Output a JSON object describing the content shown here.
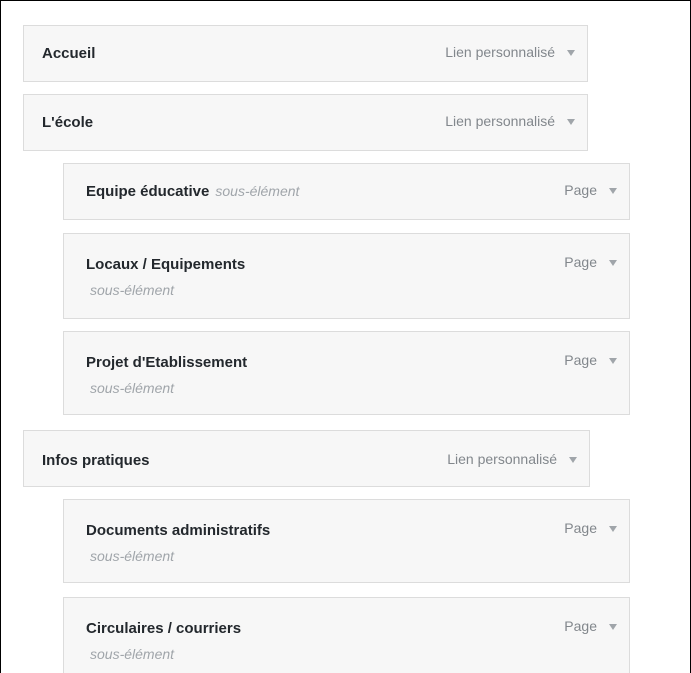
{
  "menu": {
    "items": [
      {
        "title": "Accueil",
        "type": "Lien personnalisé",
        "sub_label": ""
      },
      {
        "title": "L'école",
        "type": "Lien personnalisé",
        "sub_label": ""
      },
      {
        "title": "Equipe éducative",
        "type": "Page",
        "sub_label": "sous-élément"
      },
      {
        "title": "Locaux / Equipements",
        "type": "Page",
        "sub_label": "sous-élément"
      },
      {
        "title": "Projet d'Etablissement",
        "type": "Page",
        "sub_label": "sous-élément"
      },
      {
        "title": "Infos pratiques",
        "type": "Lien personnalisé",
        "sub_label": ""
      },
      {
        "title": "Documents administratifs",
        "type": "Page",
        "sub_label": "sous-élément"
      },
      {
        "title": "Circulaires / courriers",
        "type": "Page",
        "sub_label": "sous-élément"
      }
    ]
  },
  "icons": {
    "item_toggle": "triangle-down-icon"
  }
}
